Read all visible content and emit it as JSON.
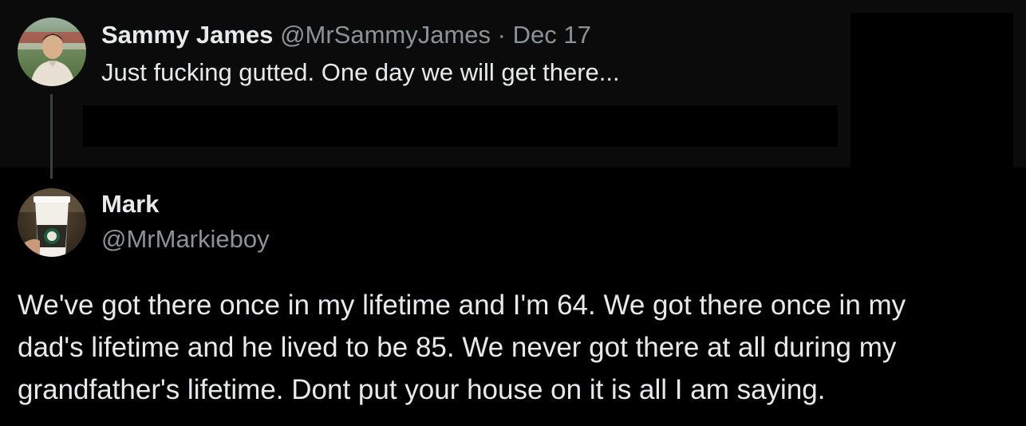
{
  "colors": {
    "background": "#000000",
    "parent_background": "#0b0b0b",
    "primary_text": "#e7e9ea",
    "secondary_text": "#8b9298",
    "thread_line": "#3a3f44"
  },
  "parent_tweet": {
    "avatar_icon": "user-avatar-photo-icon",
    "display_name": "Sammy James",
    "meta": "@MrSammyJames · Dec 17",
    "text": "Just fucking gutted. One day we will get there..."
  },
  "reply_tweet": {
    "avatar_icon": "user-avatar-coffee-cup-icon",
    "display_name": "Mark",
    "handle": "@MrMarkieboy",
    "body_lines": [
      "We've got there once in my lifetime and I'm 64.  We got there once in my",
      "dad's lifetime and he lived to be 85.  We never got there at all during my",
      "grandfather's lifetime.  Dont put your house on it is all I am saying."
    ]
  }
}
